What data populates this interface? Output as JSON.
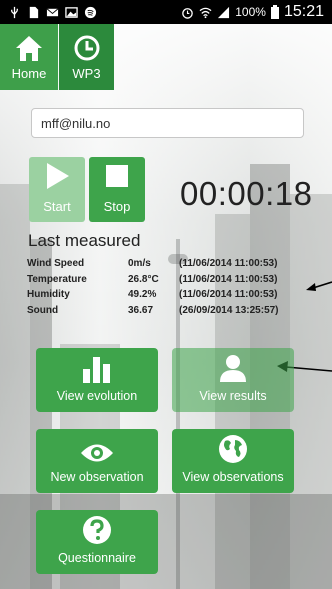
{
  "status_bar": {
    "battery": "100%",
    "time": "15:21"
  },
  "tabs": [
    {
      "label": "Home"
    },
    {
      "label": "WP3"
    }
  ],
  "email_field": {
    "value": "mff@nilu.no"
  },
  "controls": {
    "start_label": "Start",
    "stop_label": "Stop"
  },
  "timer": "00:00:18",
  "last_measured": {
    "title": "Last measured",
    "rows": [
      {
        "name": "Wind Speed",
        "value": "0m/s",
        "timestamp": "(11/06/2014 11:00:53)"
      },
      {
        "name": "Temperature",
        "value": "26.8°C",
        "timestamp": "(11/06/2014 11:00:53)"
      },
      {
        "name": "Humidity",
        "value": "49.2%",
        "timestamp": "(11/06/2014 11:00:53)"
      },
      {
        "name": "Sound",
        "value": "36.67",
        "timestamp": "(26/09/2014 13:25:57)"
      }
    ]
  },
  "buttons": {
    "view_evolution": "View evolution",
    "view_results": "View results",
    "new_observation": "New observation",
    "view_observations": "View observations",
    "questionnaire": "Questionnaire"
  },
  "colors": {
    "accent": "#3ea44b",
    "accent_dark": "#2c8a3c",
    "start_disabled": "#9bd1a1"
  }
}
